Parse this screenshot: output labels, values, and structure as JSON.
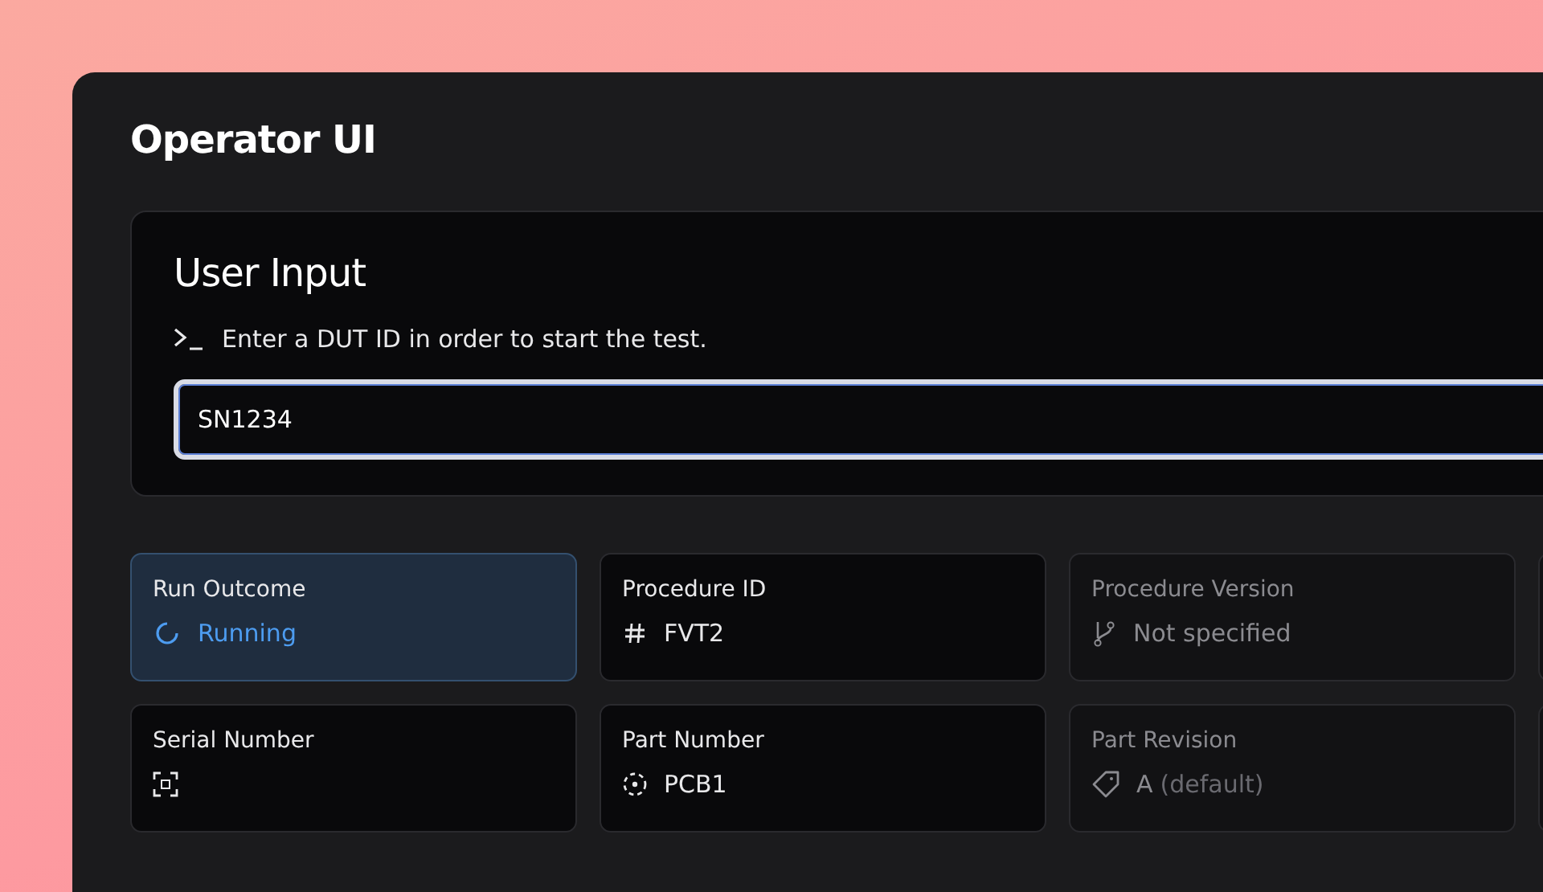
{
  "window": {
    "title": "Operator UI"
  },
  "user_input": {
    "title": "User Input",
    "prompt": "Enter a DUT ID in order to start the test.",
    "value": "SN1234",
    "focused": true
  },
  "cards": [
    {
      "label": "Run Outcome",
      "kind": "status",
      "value": "Running"
    },
    {
      "label": "Procedure ID",
      "kind": "normal",
      "value": "FVT2"
    },
    {
      "label": "Procedure Version",
      "kind": "muted",
      "value": "Not specified"
    },
    {
      "label": "Serial Number",
      "kind": "normal"
    },
    {
      "label": "Part Number",
      "kind": "normal",
      "value": "PCB1"
    },
    {
      "label": "Part Revision",
      "kind": "muted",
      "value": "A",
      "note": "(default)"
    }
  ]
}
